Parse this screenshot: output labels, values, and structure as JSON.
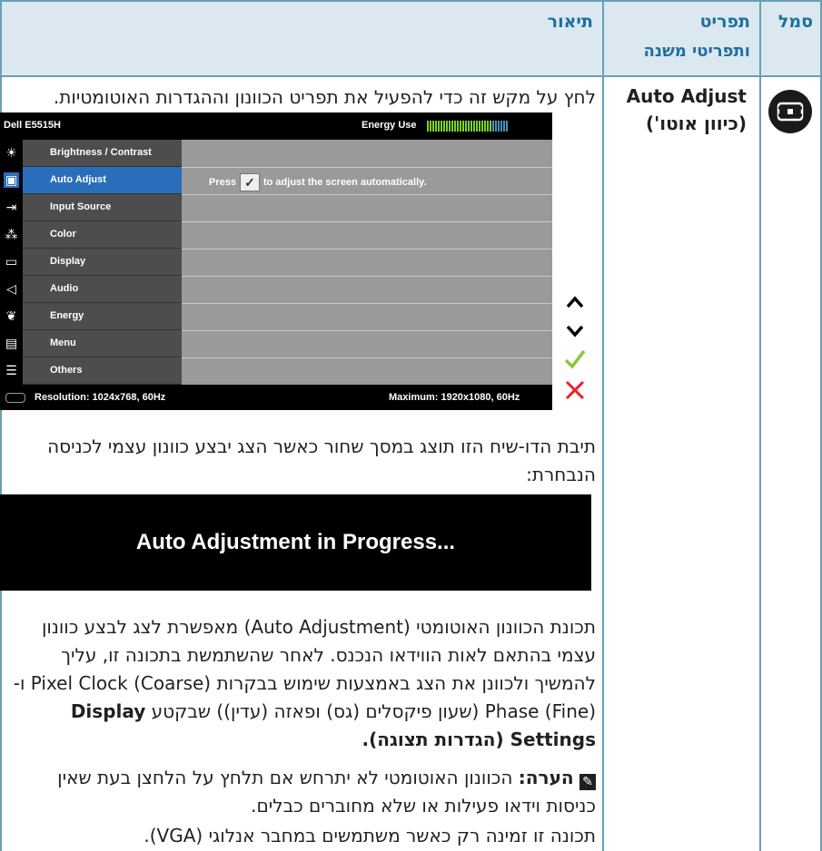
{
  "header": {
    "symbol": "סמל",
    "menu_line1": "תפריט",
    "menu_line2": "ותפריטי משנה",
    "description": "תיאור"
  },
  "row": {
    "name_en": "Auto Adjust",
    "name_he": "(כיוון אוטו')",
    "icon": "auto-adjust-icon",
    "intro": "לחץ על מקש זה כדי להפעיל את תפריט הכוונון וההגדרות האוטומטיות."
  },
  "osd": {
    "title": "Dell E5515H",
    "energy_label": "Energy Use",
    "energy_level": 0.8,
    "menu_items": [
      {
        "label": "Brightness / Contrast",
        "icon": "brightness-icon"
      },
      {
        "label": "Auto Adjust",
        "icon": "auto-adjust-icon",
        "selected": true
      },
      {
        "label": "Input Source",
        "icon": "input-source-icon"
      },
      {
        "label": "Color",
        "icon": "color-icon"
      },
      {
        "label": "Display",
        "icon": "display-icon"
      },
      {
        "label": "Audio",
        "icon": "audio-icon"
      },
      {
        "label": "Energy",
        "icon": "energy-icon"
      },
      {
        "label": "Menu",
        "icon": "menu-icon"
      },
      {
        "label": "Others",
        "icon": "others-icon"
      }
    ],
    "press_text_before": "Press",
    "press_text_after": "to adjust the screen automatically.",
    "resolution": "Resolution: 1024x768, 60Hz",
    "maximum": "Maximum: 1920x1080, 60Hz",
    "buttons": [
      "up-arrow-icon",
      "down-arrow-icon",
      "check-icon",
      "close-icon"
    ],
    "colors": {
      "accent": "#2a6ebb",
      "check": "#8cc63f",
      "close": "#e8242b"
    }
  },
  "dialog_text": "תיבת הדו-שיח הזו תוצג במסך שחור כאשר הצג יבצע כוונון עצמי לכניסה הנבחרת:",
  "progress_text": "Auto Adjustment in Progress...",
  "feature_p1": "תכונת הכוונון האוטומטי (Auto Adjustment) מאפשרת לצג לבצע כוונון עצמי בהתאם לאות הווידאו הנכנס. לאחר שהשתמשת בתכונה זו, עליך להמשיך ולכוונן את הצג באמצעות שימוש בבקרות Pixel Clock (Coarse) ו-Phase (Fine) (שעון פיקסלים (גס) ופאזה (עדין)) שבקטע",
  "feature_p1_bold": "Display Settings (הגדרות תצוגה).",
  "note_label": "הערה:",
  "note_text": "הכוונון האוטומטי לא יתרחש אם תלחץ על הלחצן בעת שאין כניסות וידאו פעילות או שלא מחוברים כבלים.",
  "vga_text": "תכונה זו זמינה רק כאשר משתמשים במחבר אנלוגי (VGA)."
}
